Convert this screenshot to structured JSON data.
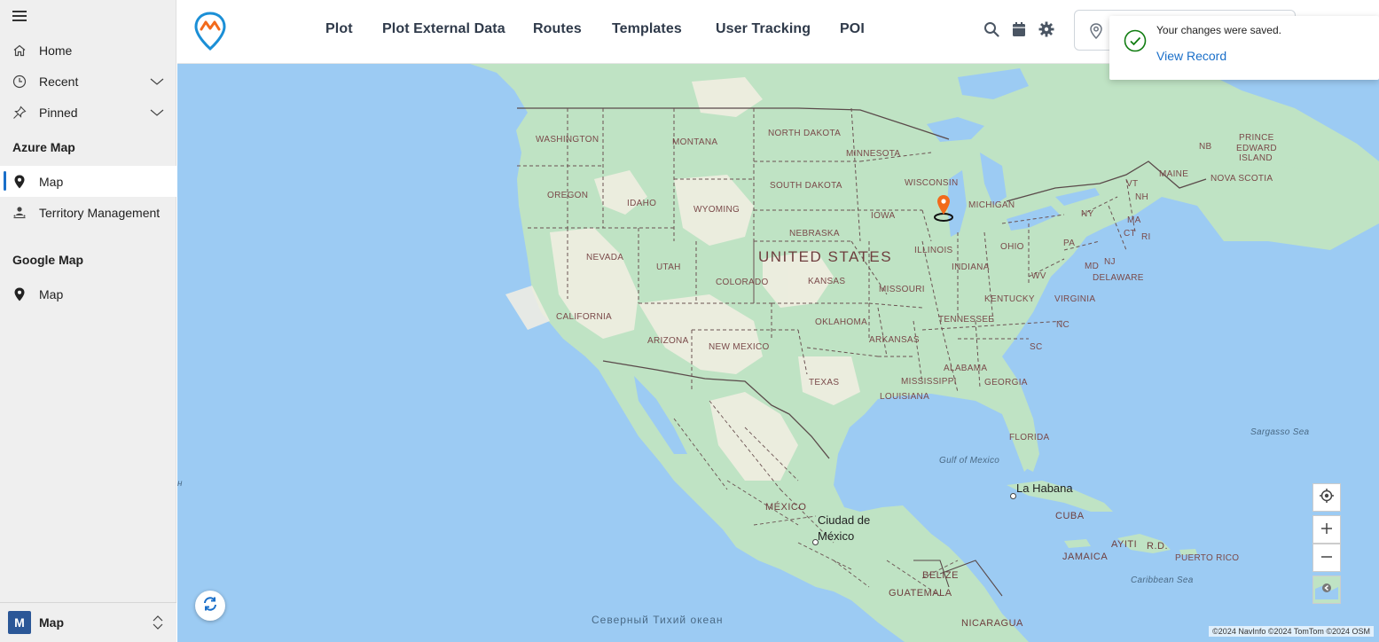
{
  "sidebar": {
    "nav": [
      {
        "label": "Home",
        "icon": "home-icon"
      },
      {
        "label": "Recent",
        "icon": "clock-icon"
      },
      {
        "label": "Pinned",
        "icon": "pin-icon"
      }
    ],
    "azure_section": "Azure Map",
    "azure_items": [
      {
        "label": "Map",
        "icon": "map-marker-icon",
        "active": true
      },
      {
        "label": "Territory Management",
        "icon": "territory-icon"
      }
    ],
    "google_section": "Google Map",
    "google_items": [
      {
        "label": "Map",
        "icon": "map-marker-icon"
      }
    ],
    "area_badge": "M",
    "area_label": "Map"
  },
  "header": {
    "tabs": [
      "Plot",
      "Plot External Data",
      "Routes",
      "Templates",
      "User Tracking",
      "POI"
    ],
    "icons": [
      "search-icon",
      "calendar-icon",
      "gear-icon"
    ]
  },
  "toast": {
    "message": "Your changes were saved.",
    "link": "View Record",
    "accent": "#107c10"
  },
  "map": {
    "labels": {
      "country_us": "UNITED STATES",
      "mexico": "MÉXICO",
      "washington": "WASHINGTON",
      "montana": "MONTANA",
      "north_dakota": "NORTH DAKOTA",
      "minnesota": "MINNESOTA",
      "oregon": "OREGON",
      "idaho": "IDAHO",
      "wyoming": "WYOMING",
      "south_dakota": "SOUTH DAKOTA",
      "wisconsin": "WISCONSIN",
      "michigan": "MICHIGAN",
      "iowa": "IOWA",
      "nebraska": "NEBRASKA",
      "nevada": "NEVADA",
      "utah": "UTAH",
      "illinois": "ILLINOIS",
      "indiana": "INDIANA",
      "ohio": "OHIO",
      "pa": "PA",
      "ny": "NY",
      "colorado": "COLORADO",
      "kansas": "KANSAS",
      "missouri": "MISSOURI",
      "kentucky": "KENTUCKY",
      "wv": "WV",
      "virginia": "VIRGINIA",
      "md": "MD",
      "nj": "NJ",
      "delaware": "DELAWARE",
      "california": "CALIFORNIA",
      "arizona": "ARIZONA",
      "new_mexico": "NEW MEXICO",
      "oklahoma": "OKLAHOMA",
      "arkansas": "ARKANSAS",
      "tennessee": "TENNESSEE",
      "nc": "NC",
      "sc": "SC",
      "texas": "TEXAS",
      "mississippi": "MISSISSIPPI",
      "alabama": "ALABAMA",
      "georgia": "GEORGIA",
      "louisiana": "LOUISIANA",
      "florida": "FLORIDA",
      "vt": "VT",
      "nh": "NH",
      "ma": "MA",
      "ct": "CT",
      "ri": "RI",
      "maine": "MAINE",
      "nb": "NB",
      "pei1": "PRINCE",
      "pei2": "EDWARD",
      "pei3": "ISLAND",
      "nova_scotia": "NOVA SCOTIA",
      "gulf": "Gulf of Mexico",
      "sargasso": "Sargasso Sea",
      "caribbean": "Caribbean Sea",
      "la_habana": "La Habana",
      "cuba": "CUBA",
      "ciudad1": "Ciudad de",
      "ciudad2": "México",
      "jamaica": "JAMAICA",
      "haiti": "AYITI",
      "rd": "R.D.",
      "puerto_rico": "PUERTO RICO",
      "belize": "BELIZE",
      "guatemala": "GUATEMALA",
      "nicaragua": "NICARAGUA",
      "pacific": "Северный Тихий океан",
      "edge_h": "н"
    },
    "attribution": "©2024 NavInfo  ©2024 TomTom  ©2024 OSM",
    "marker_color": "#f26a1b"
  }
}
